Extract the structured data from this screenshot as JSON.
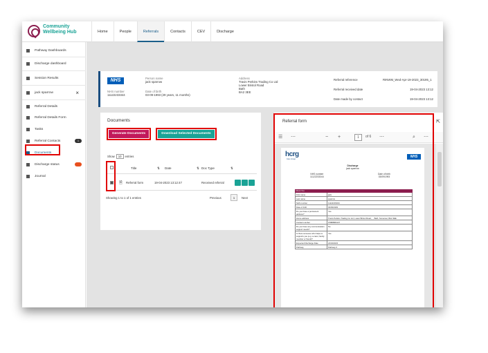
{
  "app": {
    "logo_line1": "Community",
    "logo_line2": "Wellbeing Hub"
  },
  "nav": [
    "Home",
    "People",
    "Referrals",
    "Contacts",
    "CEV",
    "Discharge"
  ],
  "sidebar": {
    "items": [
      {
        "label": "Pathway Dashboards",
        "icon": "pathway-icon"
      },
      {
        "label": "Discharge dashboard",
        "icon": "bed-icon"
      },
      {
        "label": "Session Results",
        "icon": "search-icon"
      },
      {
        "label": "jack sparrow",
        "icon": "user-file-icon"
      },
      {
        "label": "Referral Details",
        "icon": "folder-icon"
      },
      {
        "label": "Referral Details Form",
        "icon": "folder-icon"
      },
      {
        "label": "Tasks",
        "icon": "list-icon"
      },
      {
        "label": "Referral Contacts",
        "icon": "contact-icon",
        "badge": "1"
      },
      {
        "label": "Documents",
        "icon": "document-icon"
      },
      {
        "label": "Discharge status",
        "icon": "bed-icon"
      },
      {
        "label": "Journal",
        "icon": "journal-icon"
      }
    ],
    "close": "×"
  },
  "patient": {
    "nhs_logo": "NHS",
    "nhs_number_label": "NHS number",
    "nhs_number": "11122233344",
    "name_label": "Person name",
    "name": "jack sparrow",
    "dob_label": "Date of birth",
    "dob": "03-09-1993 (29 years, 11 months)",
    "address_label": "Address",
    "address_lines": [
      "Travis Perkins Trading Co Ltd",
      "Lower Bristol Road",
      "Bath",
      "BA2 3EE"
    ],
    "ref_label": "Referral reference",
    "ref": "RINWM_Wed-Apr-19-2023_30195_1",
    "received_label": "Referral received date",
    "received": "19-04-2023 13:12",
    "contact_label": "Date made by contact",
    "contact_date": "19-04-2023 13:12"
  },
  "documents": {
    "title": "Documents",
    "generate_label": "Generate Documents",
    "download_label": "Download Selected Documents",
    "show_label": "Show",
    "show_value": "10",
    "entries_label": "entries",
    "columns": [
      "Title",
      "Date",
      "Doc Type"
    ],
    "rows": [
      {
        "title": "Referral form",
        "date": "19-04-2023 13:12:47",
        "doc_type": "Received referral"
      }
    ],
    "info": "Showing 1 to 1 of 1 entries",
    "prev": "Previous",
    "page": "1",
    "next": "Next"
  },
  "referral_form": {
    "title": "Referral form",
    "page": "1",
    "of_pages": "of 6",
    "pdf": {
      "org_logo": "hcrg",
      "org_sub": "Care Group",
      "nhs_logo": "NHS",
      "heading": "Discharge",
      "subheading": "jack sparrow",
      "nhs_label": "NHS number",
      "nhs_value": "11122233344",
      "dob_label": "Date of birth",
      "dob_value": "03/09/1993",
      "section": "About You",
      "rows": [
        [
          "First name",
          "jack"
        ],
        [
          "Last name",
          "sparrow"
        ],
        [
          "NHS number",
          "11122233344"
        ],
        [
          "Date of birth",
          "03/09/1993"
        ],
        [
          "Do you have a permanent address?",
          "Yes"
        ],
        [
          "Home address",
          "Travis Perkins Trading Co Ltd, Lower Bristol Road, , , Bath, Somerset, BA2 3EE"
        ],
        [
          "Contact number",
          "07888883137"
        ],
        [
          "Do you have any communication support needs?",
          "No"
        ],
        [
          "Is there someone who helps or supports you (e.g. a carer, family member or friend)?",
          "Yes"
        ],
        [
          "Expected Discharge Date",
          "24/04/2023"
        ],
        [
          "Pathway",
          "Pathway 0"
        ]
      ]
    }
  },
  "colors": {
    "highlight": "#e00000",
    "teal": "#1aa396",
    "magenta": "#c2185b",
    "nhs_blue": "#005eb8"
  }
}
